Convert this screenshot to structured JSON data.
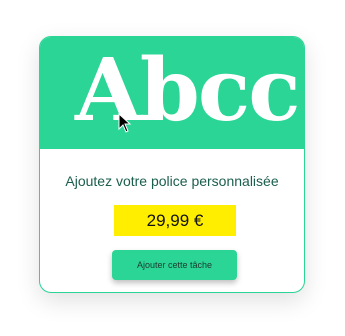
{
  "card": {
    "banner_preview_text": "Abcc",
    "title": "Ajoutez votre police personnalisée",
    "price": "29,99 €",
    "add_button_label": "Ajouter cette tâche"
  },
  "colors": {
    "accent": "#2ad596",
    "price_highlight": "#ffee00",
    "title_text": "#1b5e4d"
  },
  "icons": {
    "cursor": "mouse-cursor-icon"
  }
}
